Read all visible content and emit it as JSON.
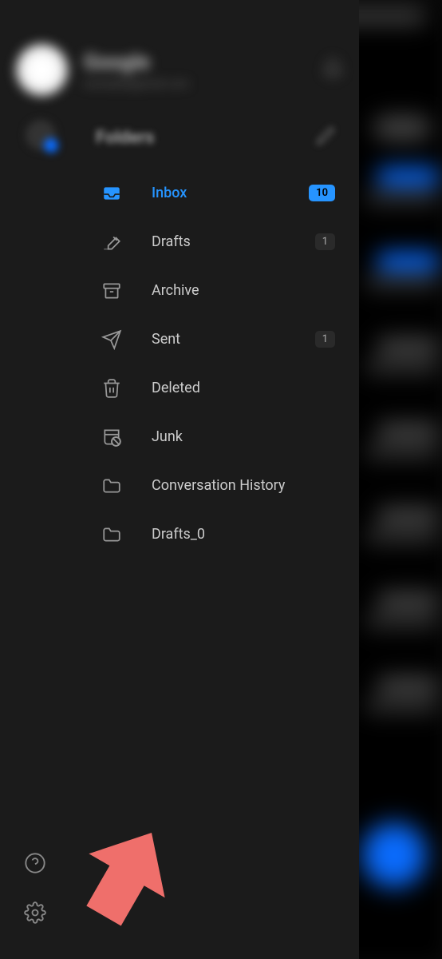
{
  "account": {
    "name": "Google",
    "email": "example@gmail.com"
  },
  "folders_header": "Folders",
  "folders": [
    {
      "id": "inbox",
      "label": "Inbox",
      "icon": "inbox",
      "badge": "10",
      "active": true
    },
    {
      "id": "drafts",
      "label": "Drafts",
      "icon": "drafts",
      "badge": "1",
      "active": false
    },
    {
      "id": "archive",
      "label": "Archive",
      "icon": "archive",
      "badge": null,
      "active": false
    },
    {
      "id": "sent",
      "label": "Sent",
      "icon": "sent",
      "badge": "1",
      "active": false
    },
    {
      "id": "deleted",
      "label": "Deleted",
      "icon": "trash",
      "badge": null,
      "active": false
    },
    {
      "id": "junk",
      "label": "Junk",
      "icon": "junk",
      "badge": null,
      "active": false
    },
    {
      "id": "conversation-history",
      "label": "Conversation History",
      "icon": "folder",
      "badge": null,
      "active": false
    },
    {
      "id": "drafts-0",
      "label": "Drafts_0",
      "icon": "folder",
      "badge": null,
      "active": false
    }
  ],
  "colors": {
    "accent": "#2694ff",
    "background": "#1c1c1c",
    "text_primary": "#ccc",
    "text_muted": "#888"
  }
}
